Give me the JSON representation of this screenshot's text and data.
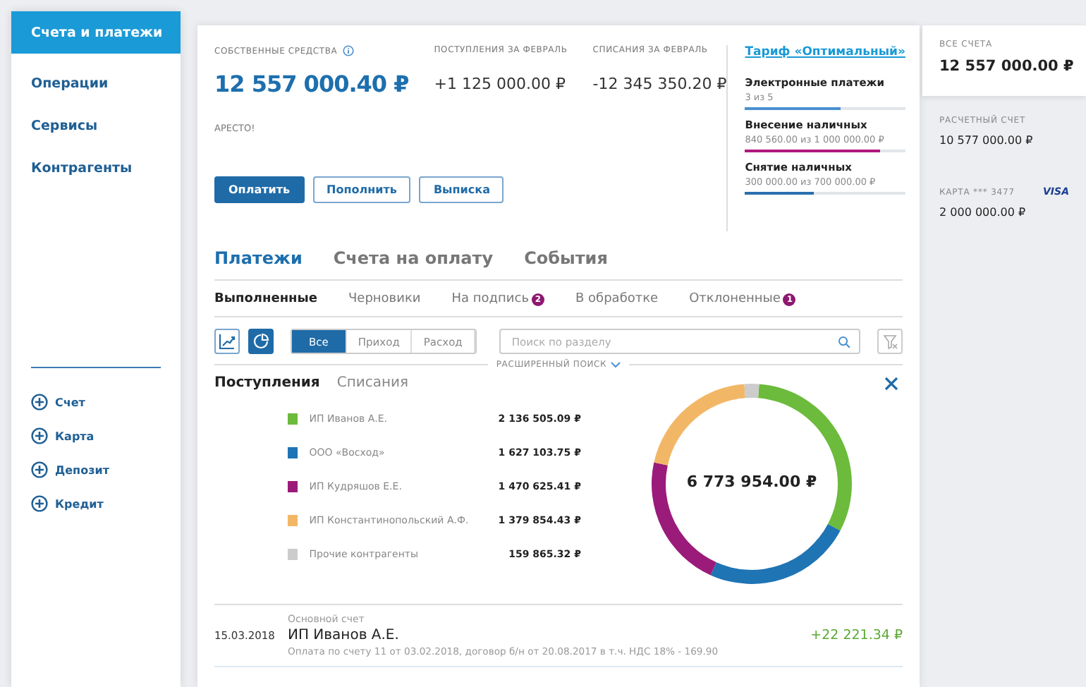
{
  "sidebar": {
    "items": [
      {
        "label": "Счета и платежи",
        "selected": true
      },
      {
        "label": "Операции",
        "selected": false
      },
      {
        "label": "Сервисы",
        "selected": false
      },
      {
        "label": "Контрагенты",
        "selected": false
      }
    ],
    "add_items": [
      "Счет",
      "Карта",
      "Депозит",
      "Кредит"
    ]
  },
  "summary": {
    "own_funds": {
      "label": "СОБСТВЕННЫЕ СРЕДСТВА",
      "value": "12 557 000.40 ₽"
    },
    "income": {
      "label": "ПОСТУПЛЕНИЯ ЗА ФЕВРАЛЬ",
      "value": "+1 125 000.00 ₽"
    },
    "outcome": {
      "label": "СПИСАНИЯ ЗА ФЕВРАЛЬ",
      "value": "-12 345 350.20 ₽"
    },
    "arrests": "АРЕСТО!",
    "buttons": [
      {
        "label": "Оплатить",
        "kind": "primary"
      },
      {
        "label": "Пополнить",
        "kind": "outline"
      },
      {
        "label": "Выписка",
        "kind": "outline"
      }
    ]
  },
  "tariff": {
    "title": "Тариф «Оптимальный»",
    "meters": [
      {
        "name": "Электронные платежи",
        "reading": "3 из 5",
        "level": 0.6,
        "color": "#4a90d0"
      },
      {
        "name": "Внесение наличных",
        "reading": "840 560.00 из 1 000 000.00 ₽",
        "level": 0.84,
        "color": "#b0187c"
      },
      {
        "name": "Снятие наличных",
        "reading": "300 000.00 из 700 000.00 ₽",
        "level": 0.43,
        "color": "#2a6fae"
      }
    ]
  },
  "accounts": [
    {
      "label": "ВСЕ СЧЕТА",
      "value": "12 557 000.00 ₽",
      "selected": true
    },
    {
      "label": "РАСЧЕТНЫЙ СЧЕТ",
      "value": "10 577 000.00 ₽",
      "selected": false
    },
    {
      "label": "КАРТА *** 3477",
      "value": "2 000 000.00 ₽",
      "selected": false,
      "brand": "VISA"
    }
  ],
  "tabs": [
    {
      "label": "Платежи",
      "selected": true
    },
    {
      "label": "Счета на оплату",
      "selected": false
    },
    {
      "label": "События",
      "selected": false
    }
  ],
  "subtabs": [
    {
      "label": "Выполненные",
      "selected": true
    },
    {
      "label": "Черновики",
      "selected": false
    },
    {
      "label": "На подпись",
      "selected": false,
      "badge": "2"
    },
    {
      "label": "В обработке",
      "selected": false
    },
    {
      "label": "Отклоненные",
      "selected": false,
      "badge": "1"
    }
  ],
  "view_toggles": [
    {
      "kind": "line",
      "selected": false
    },
    {
      "kind": "pie",
      "selected": true
    }
  ],
  "filter": [
    {
      "label": "Все",
      "selected": true
    },
    {
      "label": "Приход",
      "selected": false
    },
    {
      "label": "Расход",
      "selected": false
    }
  ],
  "search": {
    "placeholder": "Поиск по разделу"
  },
  "advanced_search": "РАСШИРЕННЫЙ ПОИСК",
  "flow_tabs": [
    {
      "label": "Поступления",
      "selected": true
    },
    {
      "label": "Списания",
      "selected": false
    }
  ],
  "legend": [
    {
      "amount": "2 136 505.09 ₽",
      "color": "#6cbb3c"
    },
    {
      "amount": "1 627 103.75 ₽",
      "color": "#1f74b4"
    },
    {
      "amount": "1 470 625.41 ₽",
      "color": "#9b1b7a"
    },
    {
      "amount": "1 379 854.43 ₽",
      "color": "#f2b766"
    },
    {
      "amount": "159 865.32 ₽",
      "color": "#cccccc"
    }
  ],
  "donut_total": "6 773 954.00 ₽",
  "chart_data": {
    "type": "donut",
    "categories": [
      "ИП Иванов А.Е.",
      "ООО «Восход»",
      "ИП Кудряшов Е.Е.",
      "ИП Константинопольский А.Ф.",
      "Прочие контрагенты"
    ],
    "values": [
      31.54,
      24.02,
      21.71,
      20.37,
      2.36
    ]
  },
  "transactions": [
    {
      "date": "15.03.2018",
      "account": "Основной счет",
      "party": "ИП Иванов А.Е.",
      "details": "Оплата по счету 11 от 03.02.2018, договор б/н от 20.08.2017 в т.ч. НДС 18% - 169.90",
      "amount": "+22 221.34 ₽"
    }
  ]
}
